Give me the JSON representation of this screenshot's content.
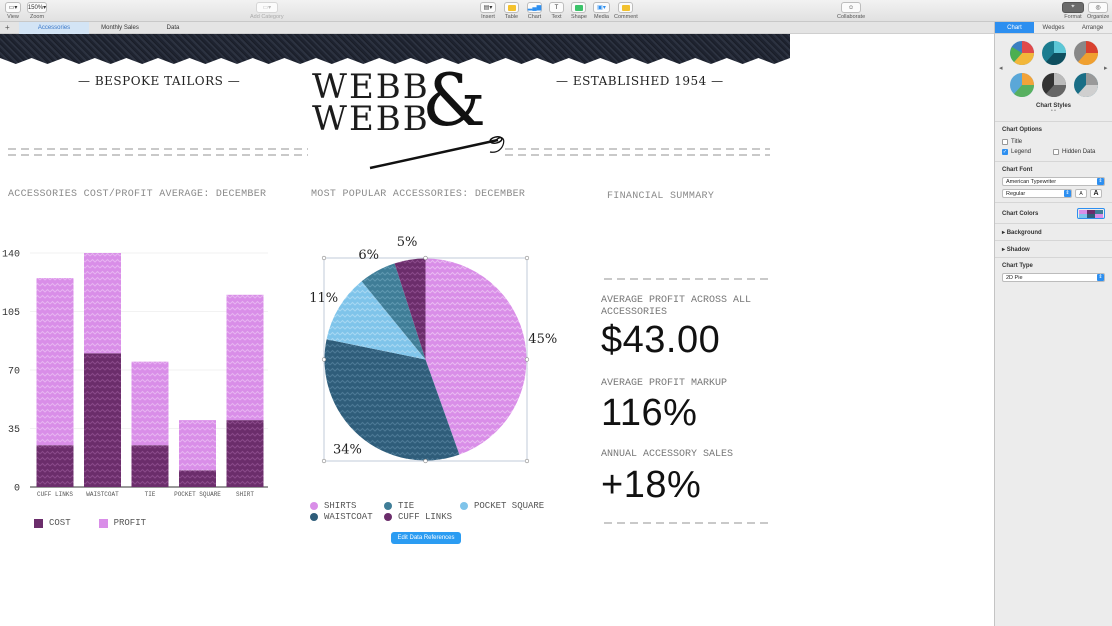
{
  "toolbar": {
    "view": "View",
    "zoom_value": "150%",
    "zoom": "Zoom",
    "add_category": "Add Category",
    "insert": "Insert",
    "table": "Table",
    "chart": "Chart",
    "text": "Text",
    "shape": "Shape",
    "media": "Media",
    "comment": "Comment",
    "collaborate": "Collaborate",
    "format": "Format",
    "organize": "Organize"
  },
  "tabs": {
    "add": "+",
    "items": [
      "Accessories",
      "Monthly Sales",
      "Data"
    ]
  },
  "page": {
    "left_header": "— BESPOKE TAILORS —",
    "right_header": "— ESTABLISHED 1954 —",
    "logo_line1": "WEBB",
    "logo_line2": "WEBB",
    "logo_amp": "&",
    "bar_title": "ACCESSORIES COST/PROFIT AVERAGE: DECEMBER",
    "pie_title": "MOST POPULAR ACCESSORIES: DECEMBER",
    "summary_title": "FINANCIAL SUMMARY",
    "stat1_label": "AVERAGE PROFIT ACROSS ALL ACCESSORIES",
    "stat1_value": "$43.00",
    "stat2_label": "AVERAGE PROFIT MARKUP",
    "stat2_value": "116%",
    "stat3_label": "ANNUAL ACCESSORY SALES",
    "stat3_value": "+18%",
    "edit_button": "Edit Data References"
  },
  "colors": {
    "cost": "#6b2d6b",
    "profit": "#d98ee8",
    "shirts": "#d98ee8",
    "waistcoat": "#2f5d7a",
    "pocket_square": "#7fc4ea",
    "tie": "#3f7d97",
    "cuff_links": "#6b2d6b",
    "accent": "#2d8ff0"
  },
  "chart_data": [
    {
      "type": "bar",
      "stacked": true,
      "categories": [
        "CUFF LINKS",
        "WAISTCOAT",
        "TIE",
        "POCKET SQUARE",
        "SHIRT"
      ],
      "series": [
        {
          "name": "COST",
          "values": [
            25,
            80,
            25,
            10,
            40
          ]
        },
        {
          "name": "PROFIT",
          "values": [
            100,
            60,
            50,
            30,
            75
          ]
        }
      ],
      "ylim": [
        0,
        140
      ],
      "yticks": [
        0,
        35,
        70,
        105,
        140
      ],
      "grid": true,
      "legend": "bottom-left"
    },
    {
      "type": "pie",
      "labels": [
        "SHIRTS",
        "WAISTCOAT",
        "POCKET SQUARE",
        "TIE",
        "CUFF LINKS"
      ],
      "values": [
        45,
        34,
        11,
        6,
        5
      ],
      "value_labels": [
        "45%",
        "34%",
        "11%",
        "6%",
        "5%"
      ],
      "legend": "bottom"
    }
  ],
  "sidebar": {
    "tabs": [
      "Chart",
      "Wedges",
      "Arrange"
    ],
    "chart_styles": "Chart Styles",
    "chart_options": "Chart Options",
    "title_opt": "Title",
    "legend_opt": "Legend",
    "hidden_data": "Hidden Data",
    "chart_font": "Chart Font",
    "font_value": "American Typewriter",
    "font_style": "Regular",
    "font_smaller": "A",
    "font_larger": "A",
    "chart_colors": "Chart Colors",
    "background": "Background",
    "shadow": "Shadow",
    "chart_type": "Chart Type",
    "chart_type_value": "2D Pie"
  }
}
